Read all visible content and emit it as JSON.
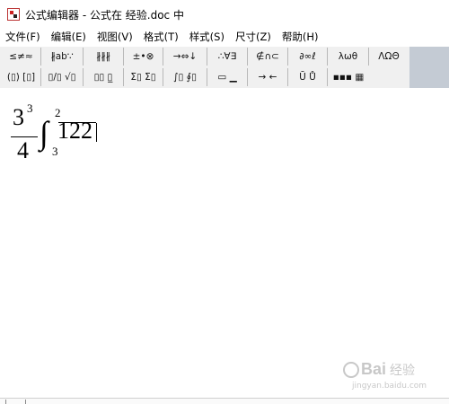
{
  "window": {
    "title": "公式编辑器 - 公式在 经验.doc 中"
  },
  "menu": [
    {
      "label": "文件(F)"
    },
    {
      "label": "编辑(E)"
    },
    {
      "label": "视图(V)"
    },
    {
      "label": "格式(T)"
    },
    {
      "label": "样式(S)"
    },
    {
      "label": "尺寸(Z)"
    },
    {
      "label": "帮助(H)"
    }
  ],
  "toolbar": {
    "row1": [
      {
        "label": "≤≠≈",
        "icon": "relations-palette-icon"
      },
      {
        "label": "∦ab∵",
        "icon": "spaces-ellipses-palette-icon"
      },
      {
        "label": "∦∦∦",
        "icon": "embellishments-palette-icon"
      },
      {
        "label": "±•⊗",
        "icon": "operators-palette-icon"
      },
      {
        "label": "→⇔↓",
        "icon": "arrows-palette-icon"
      },
      {
        "label": "∴∀∃",
        "icon": "logic-palette-icon"
      },
      {
        "label": "∉∩⊂",
        "icon": "set-theory-palette-icon"
      },
      {
        "label": "∂∞ℓ",
        "icon": "misc-symbols-palette-icon"
      },
      {
        "label": "λωθ",
        "icon": "greek-lowercase-palette-icon"
      },
      {
        "label": "ΛΩΘ",
        "icon": "greek-uppercase-palette-icon"
      }
    ],
    "row2": [
      {
        "label": "(▯) [▯]",
        "icon": "fence-templates-icon"
      },
      {
        "label": "▯/▯ √▯",
        "icon": "fraction-radical-templates-icon"
      },
      {
        "label": "▯▯ ▯̲",
        "icon": "script-templates-icon"
      },
      {
        "label": "Σ▯ Σ▯",
        "icon": "summation-templates-icon"
      },
      {
        "label": "∫▯ ∮▯",
        "icon": "integral-templates-icon"
      },
      {
        "label": "▭ ▁",
        "icon": "underbar-overbar-templates-icon"
      },
      {
        "label": "→ ←",
        "icon": "labeled-arrow-templates-icon"
      },
      {
        "label": "Ū Ů",
        "icon": "products-set-templates-icon"
      },
      {
        "label": "▪▪▪ ▦",
        "icon": "matrix-templates-icon"
      }
    ]
  },
  "equation": {
    "fraction_numerator": "3",
    "fraction_numerator_superscript": "3",
    "fraction_denominator": "4",
    "integral_symbol": "∫",
    "integral_upper": "2",
    "integral_lower": "3",
    "integrand": "122"
  },
  "watermark": {
    "brand": "Bai",
    "suffix": "经验",
    "url": "jingyan.baidu.com"
  }
}
